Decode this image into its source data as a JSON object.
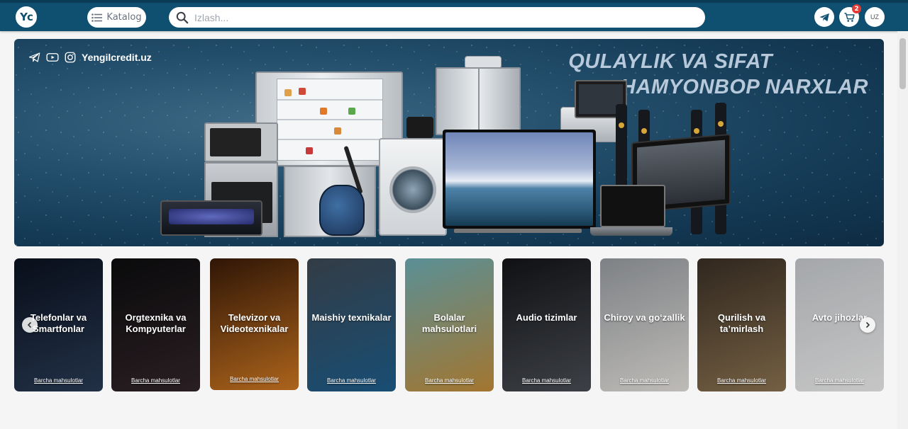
{
  "header": {
    "logo_text": "Yc",
    "katalog_label": "Katalog",
    "search_placeholder": "Izlash...",
    "cart_count": "2",
    "lang_label": "UZ"
  },
  "banner": {
    "site_label": "Yengilcredit.uz",
    "headline_line1": "QULAYLIK VA SIFAT",
    "headline_line2": "HAMYONBOP NARXLAR"
  },
  "categories": [
    {
      "title": "Telefonlar va Smartfonlar",
      "link": "Barcha mahsulotlar",
      "color1": "#0b1220",
      "color2": "#2a3c57"
    },
    {
      "title": "Orgtexnika va Kompyuterlar",
      "link": "Barcha mahsulotlar",
      "color1": "#0d0d0f",
      "color2": "#33262a"
    },
    {
      "title": "Televizor va Videotexnikalar",
      "link": "Barcha mahsulotlar",
      "color1": "#3a1b08",
      "color2": "#d37a22"
    },
    {
      "title": "Maishiy texnikalar",
      "link": "Barcha mahsulotlar",
      "color1": "#3f4a55",
      "color2": "#1e5f8e"
    },
    {
      "title": "Bolalar mahsulotlari",
      "link": "Barcha mahsulotlar",
      "color1": "#6fb0b8",
      "color2": "#c7903a"
    },
    {
      "title": "Audio tizimlar",
      "link": "Barcha mahsulotlar",
      "color1": "#141518",
      "color2": "#4b4f56"
    },
    {
      "title": "Chiroy va go‘zallik",
      "link": "Barcha mahsulotlar",
      "color1": "#9a9ea3",
      "color2": "#e8e5e0"
    },
    {
      "title": "Qurilish va ta’mirlash",
      "link": "Barcha mahsulotlar",
      "color1": "#3b3026",
      "color2": "#8e7552"
    },
    {
      "title": "Avto jihozlar",
      "link": "Barcha mahsulotlar",
      "color1": "#c9ccd0",
      "color2": "#f2f2f2"
    }
  ]
}
